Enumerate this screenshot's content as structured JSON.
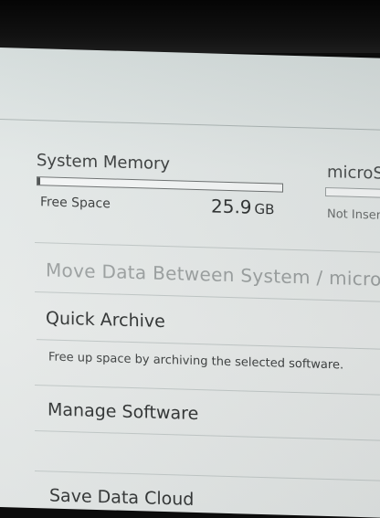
{
  "storage": {
    "system": {
      "title": "System Memory",
      "free_label": "Free Space",
      "free_value": "25.9",
      "free_unit": "GB",
      "used_fraction": 0.01
    },
    "microsd": {
      "title": "microS",
      "status": "Not Inser"
    }
  },
  "menu": {
    "move_data": "Move Data Between System / microS",
    "quick_archive": "Quick Archive",
    "quick_archive_desc": "Free up space by archiving the selected software.",
    "manage_software": "Manage Software",
    "save_data_cloud": "Save Data Cloud"
  },
  "colors": {
    "background": "#e2e7e6",
    "text": "#2f3232",
    "disabled_text": "#9a9f9f"
  }
}
